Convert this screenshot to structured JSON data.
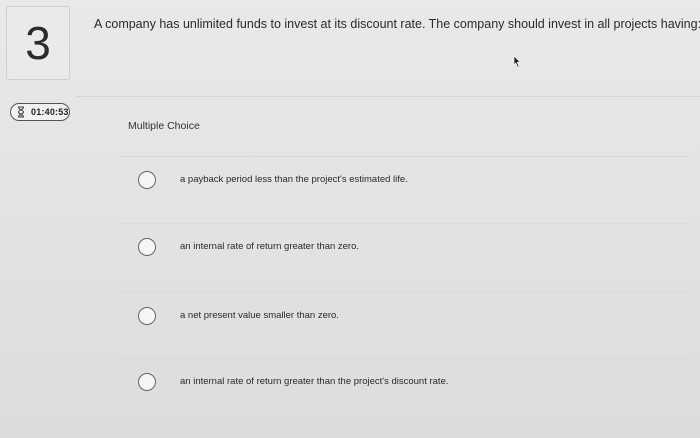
{
  "question": {
    "number": "3",
    "text": "A company has unlimited funds to invest at its discount rate. The company should invest in all projects having:"
  },
  "timer": {
    "icon": "hourglass-icon",
    "value": "01:40:53"
  },
  "answer_section": {
    "label": "Multiple Choice",
    "choices": [
      {
        "text": "a payback period less than the project's estimated life."
      },
      {
        "text": "an internal rate of return greater than zero."
      },
      {
        "text": "a net present value smaller than zero."
      },
      {
        "text": "an internal rate of return greater than the project's discount rate."
      }
    ]
  }
}
